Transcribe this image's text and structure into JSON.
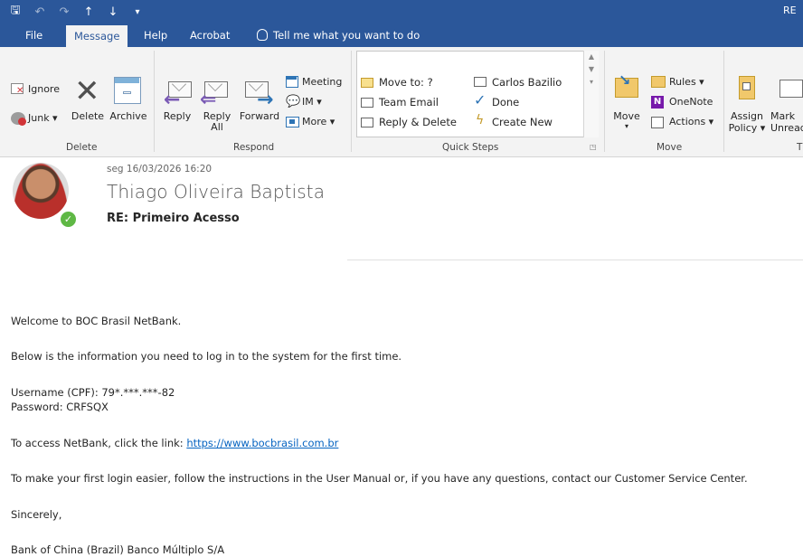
{
  "titlebar": {
    "window_title": "RE",
    "qat": {
      "save": "🖫",
      "undo": "↶",
      "redo": "↷",
      "up": "↑",
      "down": "↓",
      "customize": "₹"
    }
  },
  "tabs": {
    "file": "File",
    "message": "Message",
    "help": "Help",
    "acrobat": "Acrobat",
    "tell_me": "Tell me what you want to do"
  },
  "ribbon": {
    "delete_group": {
      "label": "Delete",
      "ignore": "Ignore",
      "junk": "Junk",
      "delete": "Delete",
      "archive": "Archive"
    },
    "respond_group": {
      "label": "Respond",
      "reply": "Reply",
      "reply_all_1": "Reply",
      "reply_all_2": "All",
      "forward": "Forward",
      "meeting": "Meeting",
      "im": "IM",
      "more": "More"
    },
    "quick_steps_group": {
      "label": "Quick Steps",
      "move_to": "Move to: ?",
      "team_email": "Team Email",
      "reply_delete": "Reply & Delete",
      "carlos": "Carlos Bazilio",
      "done": "Done",
      "create_new": "Create New"
    },
    "move_group": {
      "label": "Move",
      "move": "Move",
      "rules": "Rules",
      "onenote": "OneNote",
      "actions": "Actions"
    },
    "tags_group": {
      "label": "T",
      "assign_1": "Assign",
      "assign_2": "Policy",
      "mark_1": "Mark",
      "mark_2": "Unread"
    }
  },
  "message": {
    "date": "seg 16/03/2026 16:20",
    "from": "Thiago Oliveira Baptista",
    "subject": "RE: Primeiro Acesso"
  },
  "body": {
    "line1": "Welcome to BOC Brasil NetBank.",
    "line2": "Below is the information you need to log in to the system for the first time.",
    "line3": "Username (CPF): 79*.***.***-82",
    "line4": "Password: CRFSQX",
    "line5_prefix": "To access NetBank, click the link: ",
    "link": "https://www.bocbrasil.com.br",
    "line6": "To make your first login easier, follow the instructions in the User Manual or, if you have any questions, contact our Customer Service Center.",
    "line7": "Sincerely,",
    "line8": "Bank of China (Brazil) Banco Múltiplo S/A"
  }
}
